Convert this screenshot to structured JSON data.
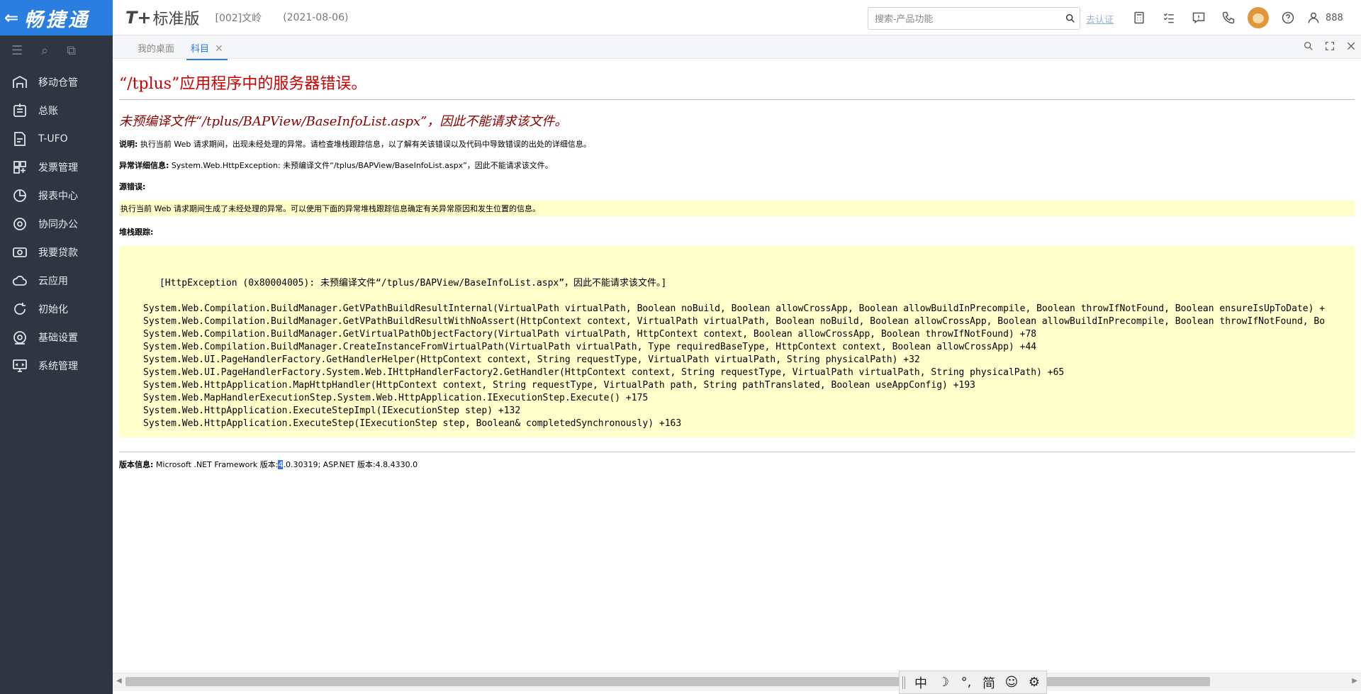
{
  "sidebar": {
    "brand": "畅捷通",
    "items": [
      {
        "label": "移动仓管",
        "icon": "mobile-warehouse-icon"
      },
      {
        "label": "总账",
        "icon": "ledger-icon"
      },
      {
        "label": "T-UFO",
        "icon": "ufo-report-icon"
      },
      {
        "label": "发票管理",
        "icon": "invoice-icon"
      },
      {
        "label": "报表中心",
        "icon": "report-pie-icon"
      },
      {
        "label": "协同办公",
        "icon": "collaboration-icon"
      },
      {
        "label": "我要贷款",
        "icon": "loan-icon"
      },
      {
        "label": "云应用",
        "icon": "cloud-icon"
      },
      {
        "label": "初始化",
        "icon": "initialize-icon"
      },
      {
        "label": "基础设置",
        "icon": "basic-settings-icon"
      },
      {
        "label": "系统管理",
        "icon": "system-admin-icon"
      }
    ]
  },
  "header": {
    "product": "T+",
    "edition": "标准版",
    "account": "[002]文岭",
    "date": "(2021-08-06)",
    "search_placeholder": "搜索-产品功能",
    "certify": "去认证",
    "user_count": "888"
  },
  "tabs": {
    "home": "我的桌面",
    "active": "科目",
    "close": "✕"
  },
  "error": {
    "title": "“/tplus”应用程序中的服务器错误。",
    "subtitle": "未预编译文件“/tplus/BAPView/BaseInfoList.aspx”，因此不能请求该文件。",
    "desc_label": "说明:",
    "desc_text": " 执行当前 Web 请求期间，出现未经处理的异常。请检查堆栈跟踪信息，以了解有关该错误以及代码中导致错误的出处的详细信息。",
    "detail_label": "异常详细信息:",
    "detail_text": " System.Web.HttpException: 未预编译文件“/tplus/BAPView/BaseInfoList.aspx”，因此不能请求该文件。",
    "source_label": "源错误:",
    "source_text": "执行当前 Web 请求期间生成了未经处理的异常。可以使用下面的异常堆栈跟踪信息确定有关异常原因和发生位置的信息。",
    "stack_label": "堆栈跟踪:",
    "stack_head": "[HttpException (0x80004005): 未预编译文件“/tplus/BAPView/BaseInfoList.aspx”，因此不能请求该文件。]",
    "stack_lines": [
      "System.Web.Compilation.BuildManager.GetVPathBuildResultInternal(VirtualPath virtualPath, Boolean noBuild, Boolean allowCrossApp, Boolean allowBuildInPrecompile, Boolean throwIfNotFound, Boolean ensureIsUpToDate) +",
      "System.Web.Compilation.BuildManager.GetVPathBuildResultWithNoAssert(HttpContext context, VirtualPath virtualPath, Boolean noBuild, Boolean allowCrossApp, Boolean allowBuildInPrecompile, Boolean throwIfNotFound, Bo",
      "System.Web.Compilation.BuildManager.GetVirtualPathObjectFactory(VirtualPath virtualPath, HttpContext context, Boolean allowCrossApp, Boolean throwIfNotFound) +78",
      "System.Web.Compilation.BuildManager.CreateInstanceFromVirtualPath(VirtualPath virtualPath, Type requiredBaseType, HttpContext context, Boolean allowCrossApp) +44",
      "System.Web.UI.PageHandlerFactory.GetHandlerHelper(HttpContext context, String requestType, VirtualPath virtualPath, String physicalPath) +32",
      "System.Web.UI.PageHandlerFactory.System.Web.IHttpHandlerFactory2.GetHandler(HttpContext context, String requestType, VirtualPath virtualPath, String physicalPath) +65",
      "System.Web.HttpApplication.MapHttpHandler(HttpContext context, String requestType, VirtualPath path, String pathTranslated, Boolean useAppConfig) +193",
      "System.Web.MapHandlerExecutionStep.System.Web.HttpApplication.IExecutionStep.Execute() +175",
      "System.Web.HttpApplication.ExecuteStepImpl(IExecutionStep step) +132",
      "System.Web.HttpApplication.ExecuteStep(IExecutionStep step, Boolean& completedSynchronously) +163"
    ],
    "version_label": "版本信息:",
    "version_pre": " Microsoft .NET Framework 版本:",
    "version_sel": "4",
    "version_post": ".0.30319; ASP.NET 版本:4.8.4330.0"
  },
  "ime": {
    "keys": [
      "中",
      "☽",
      "°,",
      "简",
      "☺",
      "⚙"
    ]
  }
}
